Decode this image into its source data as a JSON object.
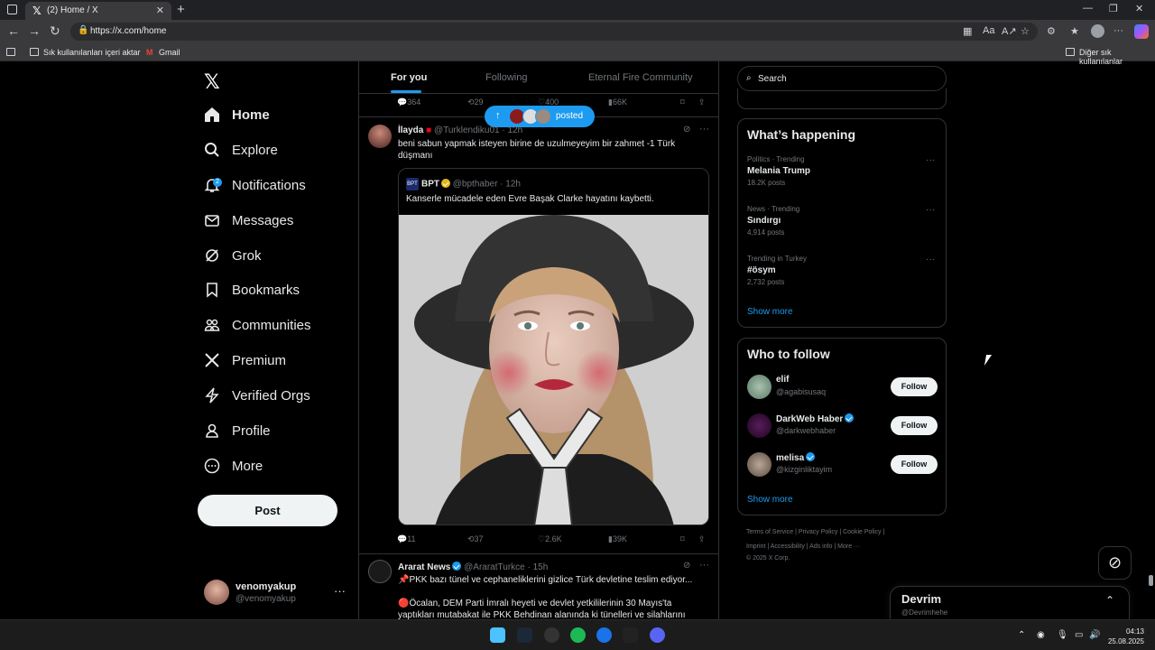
{
  "browser": {
    "tab_title": "(2) Home / X",
    "url": "https://x.com/home",
    "bookmarks": {
      "import_label": "Sık kullanılanları içeri aktar",
      "gmail_label": "Gmail",
      "other_label": "Diğer sık kullanılanlar"
    }
  },
  "nav": {
    "logo": "𝕏",
    "items": [
      {
        "label": "Home",
        "icon": "home-icon"
      },
      {
        "label": "Explore",
        "icon": "search-icon"
      },
      {
        "label": "Notifications",
        "icon": "bell-icon",
        "badge": "2"
      },
      {
        "label": "Messages",
        "icon": "envelope-icon"
      },
      {
        "label": "Grok",
        "icon": "grok-icon"
      },
      {
        "label": "Bookmarks",
        "icon": "bookmark-icon"
      },
      {
        "label": "Communities",
        "icon": "people-icon"
      },
      {
        "label": "Premium",
        "icon": "x-icon"
      },
      {
        "label": "Verified Orgs",
        "icon": "lightning-icon"
      },
      {
        "label": "Profile",
        "icon": "person-icon"
      },
      {
        "label": "More",
        "icon": "more-circle-icon"
      }
    ],
    "post_button": "Post",
    "account": {
      "name": "venomyakup",
      "handle": "@venomyakup"
    }
  },
  "feed": {
    "tabs": [
      "For you",
      "Following",
      "Eternal Fire Community"
    ],
    "active_tab": "For you",
    "posted_pill": "posted",
    "prev_actions": {
      "replies": "364",
      "reposts": "29",
      "likes": "400",
      "views": "66K"
    },
    "tweet1": {
      "name": "İlayda",
      "handle": "@Turklendiku01 · 12h",
      "text": "beni sabun yapmak isteyen birine de uzulmeyeyim bir zahmet -1 Türk düşmanı",
      "quote": {
        "name": "BPT",
        "logo": "BPT",
        "handle": "@bpthaber · 12h",
        "text": "Kanserle mücadele eden Evre Başak Clarke hayatını kaybetti."
      },
      "actions": {
        "replies": "11",
        "reposts": "37",
        "likes": "2.6K",
        "views": "39K"
      }
    },
    "tweet2": {
      "name": "Ararat News",
      "handle": "@AraratTurkce · 15h",
      "line1": "📌PKK bazı tünel ve cephaneliklerini gizlice Türk devletine teslim ediyor...",
      "line2": "🔴Öcalan, DEM Parti İmralı heyeti ve devlet yetkililerinin 30 Mayıs'ta",
      "line3": "yaptıkları mutabakat ile PKK Behdinan alanında ki tünelleri ve silahlarını"
    }
  },
  "right": {
    "search_placeholder": "Search",
    "happening_title": "What’s happening",
    "trends": [
      {
        "meta": "Politics · Trending",
        "title": "Melania Trump",
        "count": "18.2K posts"
      },
      {
        "meta": "News · Trending",
        "title": "Sındırgı",
        "count": "4,914 posts"
      },
      {
        "meta": "Trending in Turkey",
        "title": "#ösym",
        "count": "2,732 posts"
      }
    ],
    "show_more": "Show more",
    "who_title": "Who to follow",
    "follow_label": "Follow",
    "follows": [
      {
        "name": "elif",
        "handle": "@agabisusaq",
        "verified": false
      },
      {
        "name": "DarkWeb Haber",
        "handle": "@darkwebhaber",
        "verified": true
      },
      {
        "name": "melisa",
        "handle": "@kizginliktayim",
        "verified": true
      }
    ],
    "footer_line1": "Terms of Service  |  Privacy Policy  |  Cookie Policy  |",
    "footer_line2": "Imprint  |  Accessibility  |  Ads info  |  More ···",
    "footer_line3": "© 2025 X Corp.",
    "messages": {
      "title": "Devrim",
      "subtitle": "@Devrimhehe"
    }
  },
  "taskbar": {
    "time": "04:13",
    "date": "25.08.2025"
  },
  "colors": {
    "accent": "#1d9bf0",
    "background": "#000000",
    "border": "#2f3336",
    "muted": "#71767b",
    "text": "#e7e9ea"
  }
}
